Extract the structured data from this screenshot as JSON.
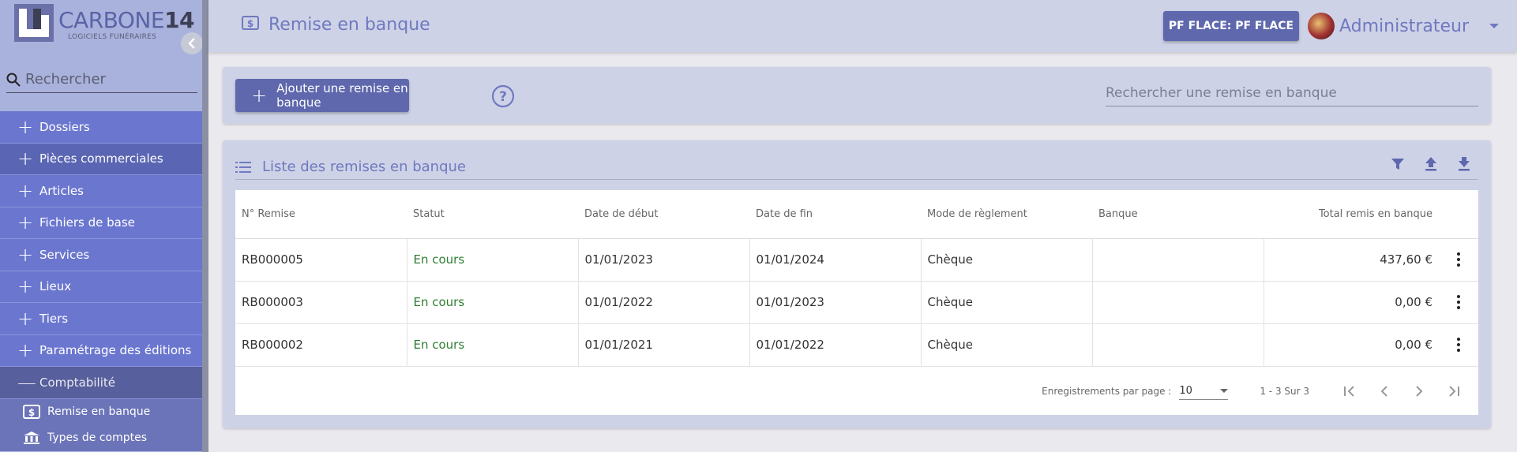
{
  "brand": {
    "name_light": "CARBONE",
    "name_bold": "14",
    "tagline": "LOGICIELS FUNÉRAIRES"
  },
  "sidebar": {
    "search_placeholder": "Rechercher",
    "items": [
      {
        "label": "Dossiers",
        "icon": "plus-icon"
      },
      {
        "label": "Pièces commerciales",
        "icon": "plus-icon"
      },
      {
        "label": "Articles",
        "icon": "plus-icon"
      },
      {
        "label": "Fichiers de base",
        "icon": "plus-icon"
      },
      {
        "label": "Services",
        "icon": "plus-icon"
      },
      {
        "label": "Lieux",
        "icon": "plus-icon"
      },
      {
        "label": "Tiers",
        "icon": "plus-icon"
      },
      {
        "label": "Paramétrage des éditions",
        "icon": "plus-icon"
      },
      {
        "label": "Comptabilité",
        "icon": "minus-icon"
      }
    ],
    "sub_items": [
      {
        "label": "Remise en banque",
        "icon": "bank-deposit-icon"
      },
      {
        "label": "Types de comptes",
        "icon": "bank-icon"
      }
    ]
  },
  "header": {
    "title": "Remise en banque",
    "pf_button": "PF FLACE: PF FLACE",
    "user_name": "Administrateur"
  },
  "toolbar": {
    "add_label": "Ajouter une remise en banque",
    "search_placeholder": "Rechercher une remise en banque"
  },
  "list": {
    "title": "Liste des remises en banque",
    "columns": [
      "N° Remise",
      "Statut",
      "Date de début",
      "Date de fin",
      "Mode de règlement",
      "Banque",
      "Total remis en banque"
    ],
    "rows": [
      {
        "num": "RB000005",
        "status": "En cours",
        "start": "01/01/2023",
        "end": "01/01/2024",
        "mode": "Chèque",
        "bank": "",
        "total": "437,60 €"
      },
      {
        "num": "RB000003",
        "status": "En cours",
        "start": "01/01/2022",
        "end": "01/01/2023",
        "mode": "Chèque",
        "bank": "",
        "total": "0,00 €"
      },
      {
        "num": "RB000002",
        "status": "En cours",
        "start": "01/01/2021",
        "end": "01/01/2022",
        "mode": "Chèque",
        "bank": "",
        "total": "0,00 €"
      }
    ]
  },
  "pager": {
    "per_page_label": "Enregistrements par page :",
    "per_page_value": "10",
    "range": "1 - 3 Sur 3"
  },
  "colors": {
    "primary": "#5f68ad",
    "sidebar": "#6b77cf",
    "status_green": "#2e7d32"
  }
}
